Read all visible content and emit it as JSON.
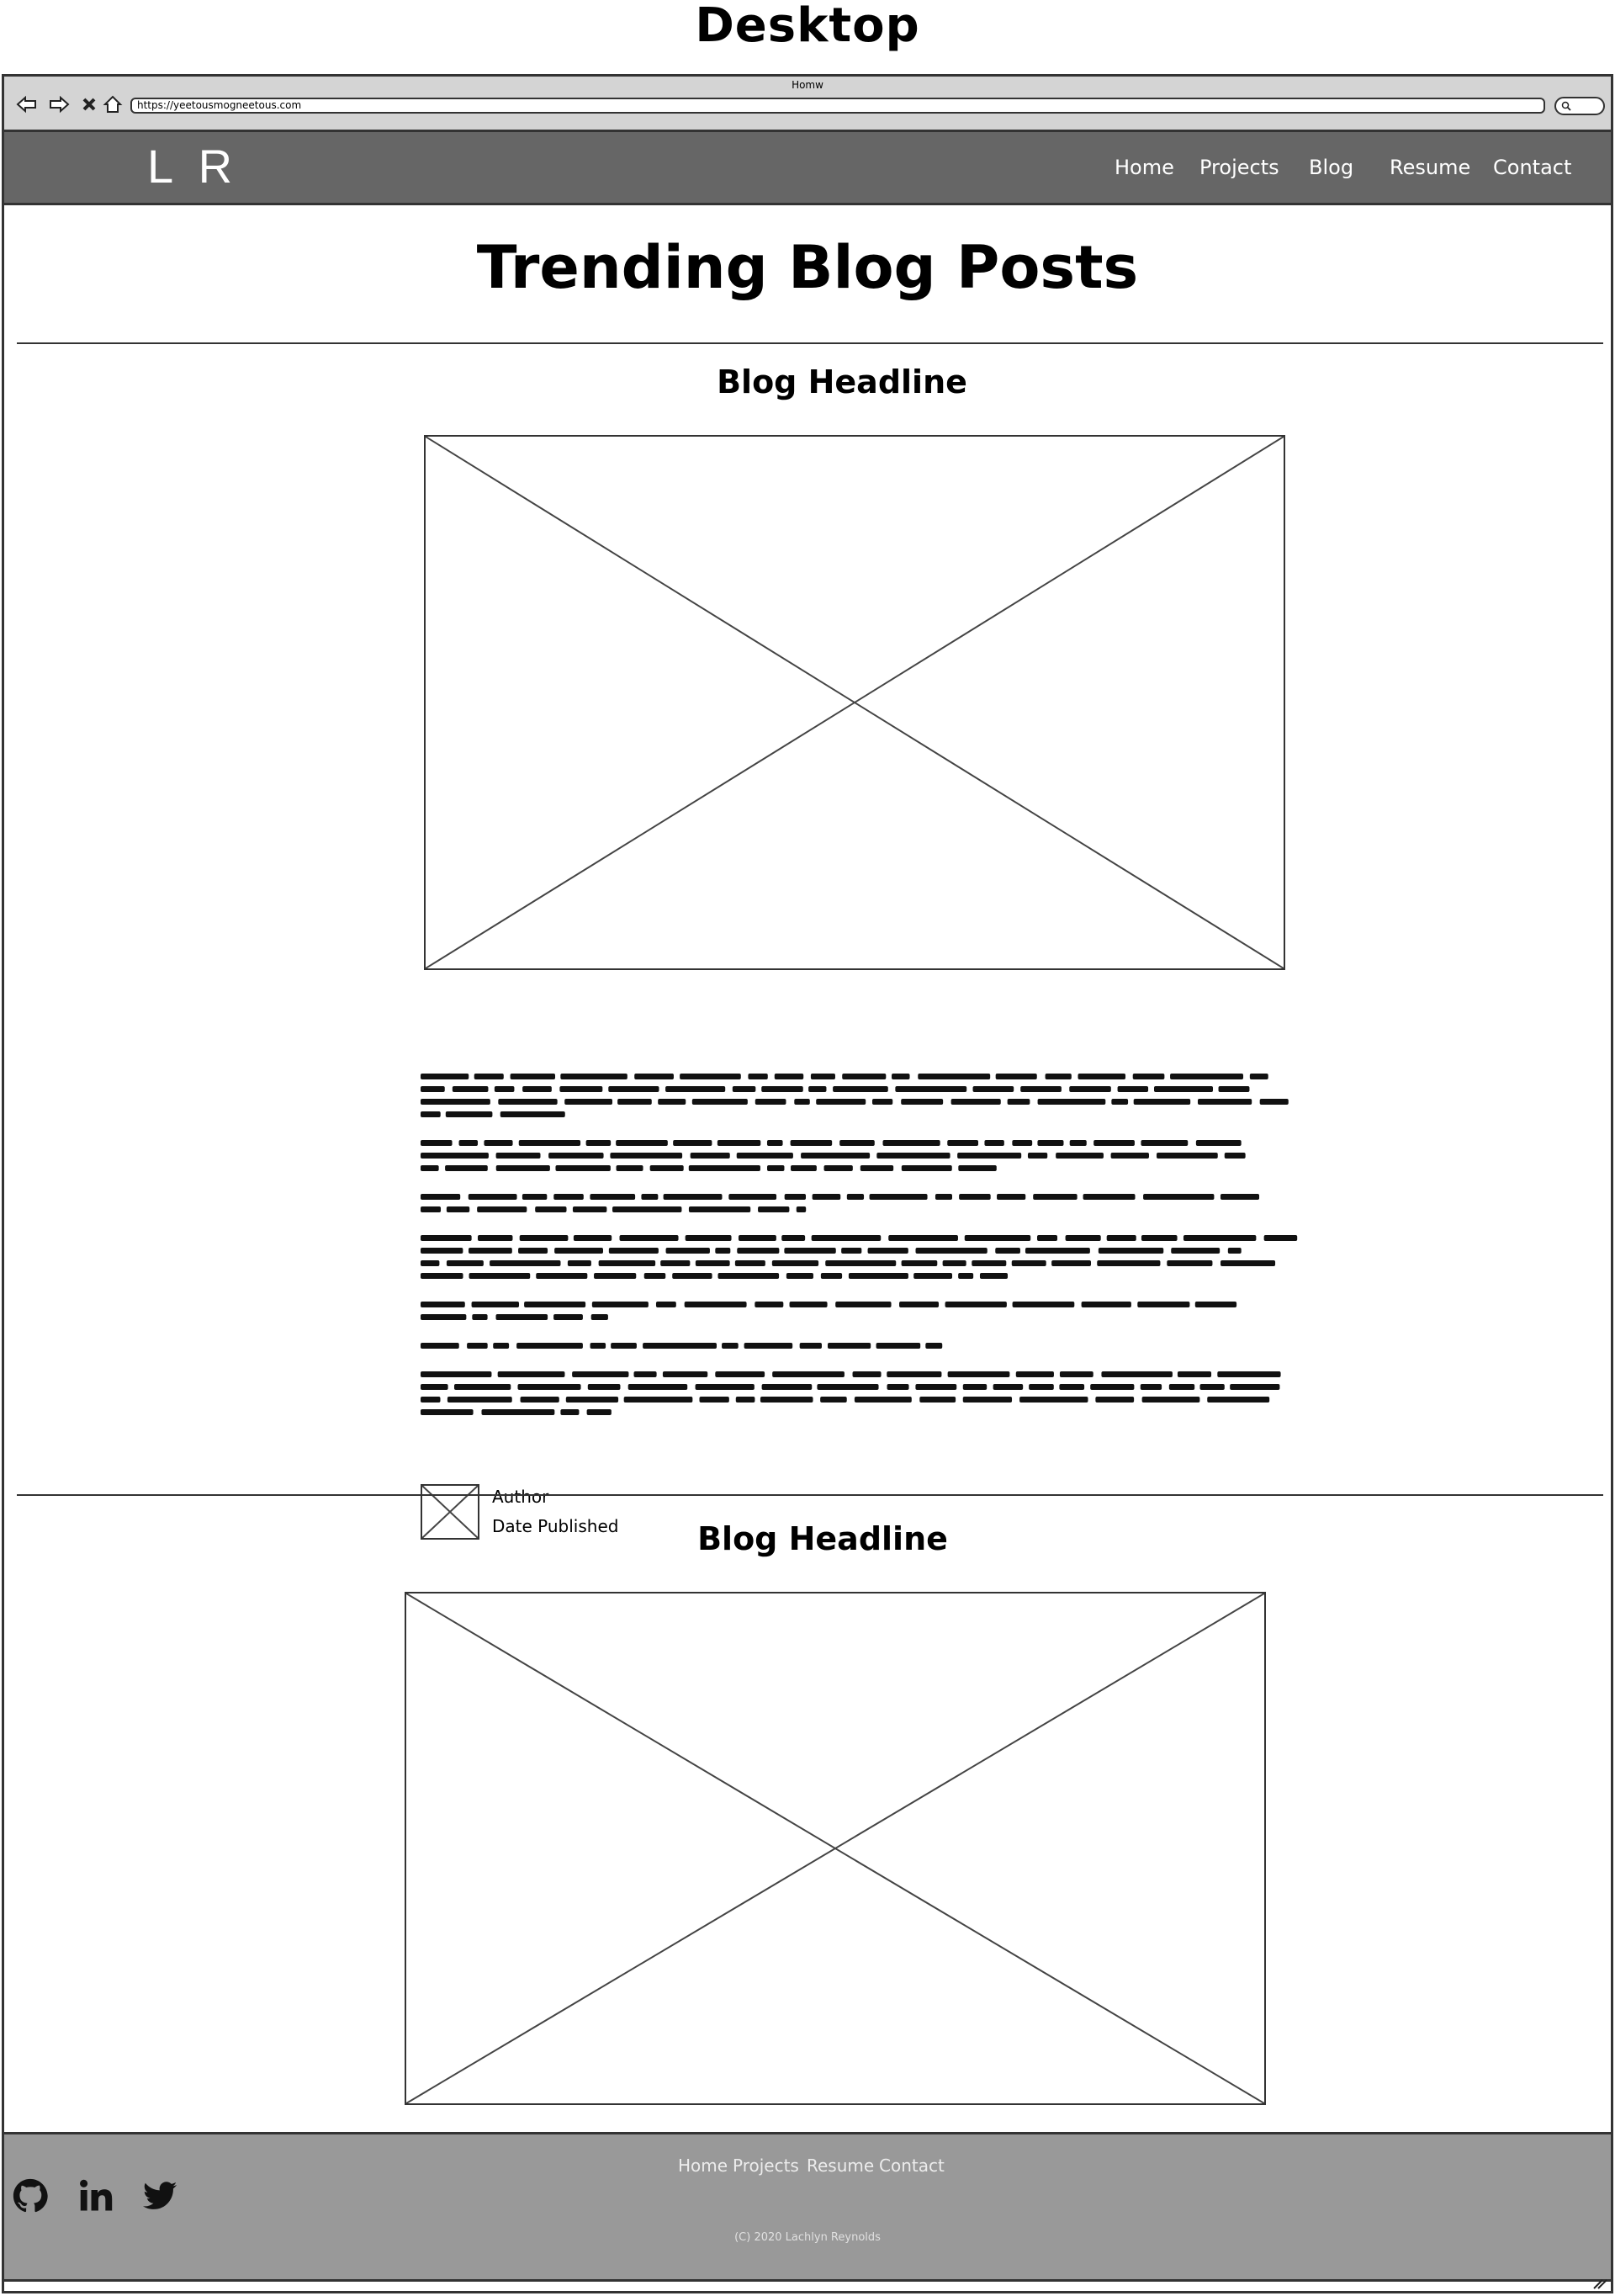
{
  "page_label": "Desktop",
  "browser": {
    "window_title": "Homw",
    "url": "https://yeetousmogneetous.com"
  },
  "site": {
    "logo": "L R",
    "nav": [
      "Home",
      "Projects",
      "Blog",
      "Resume",
      "Contact"
    ]
  },
  "main": {
    "title": "Trending Blog Posts",
    "posts": [
      {
        "headline": "Blog Headline",
        "paragraph_line_counts": [
          4,
          3,
          2,
          4,
          2,
          1,
          4
        ],
        "author": "Author",
        "date": "Date Published"
      },
      {
        "headline": "Blog Headline"
      }
    ]
  },
  "footer": {
    "links": [
      "Home",
      "Projects",
      "Resume",
      "Contact"
    ],
    "copyright": "(C) 2020 Lachlyn Reynolds",
    "social_icons": [
      "github-icon",
      "linkedin-icon",
      "twitter-icon"
    ]
  },
  "colors": {
    "nav_bg": "#666666",
    "footer_bg": "#999999",
    "chrome_bg": "#d4d4d4"
  }
}
